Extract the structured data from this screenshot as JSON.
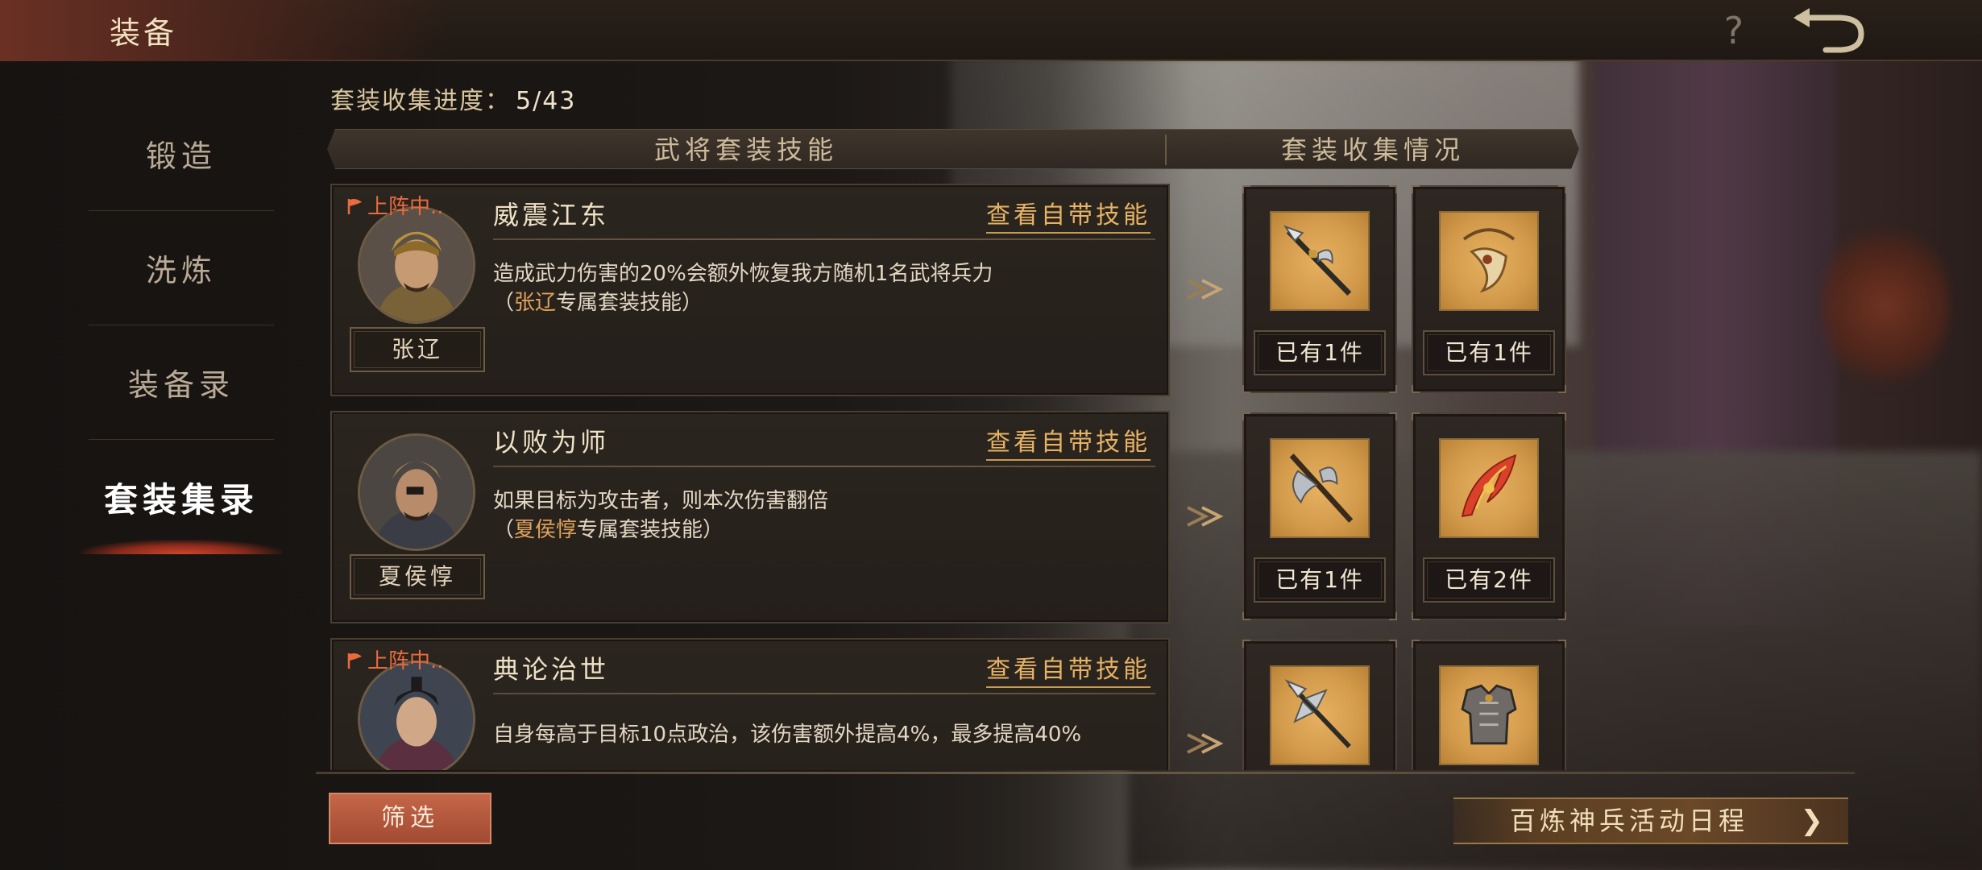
{
  "header": {
    "title": "装备",
    "help_icon": "question-mark-icon",
    "back_icon": "back-arrow-icon"
  },
  "sidebar": {
    "items": [
      {
        "label": "锻造",
        "active": false
      },
      {
        "label": "洗炼",
        "active": false
      },
      {
        "label": "装备录",
        "active": false
      },
      {
        "label": "套装集录",
        "active": true
      }
    ]
  },
  "progress": {
    "label": "套装收集进度：",
    "value": "5/43"
  },
  "columns": {
    "left": "武将套装技能",
    "right": "套装收集情况"
  },
  "sets": [
    {
      "deployed": true,
      "deployed_label": "上阵中..",
      "general": "张辽",
      "skill_name": "威震江东",
      "view_label": "查看自带技能",
      "desc": "造成武力伤害的20%会额外恢复我方随机1名武将兵力",
      "excl_open": "（",
      "excl_hero": "张辽",
      "excl_text": "专属套装技能）",
      "items": [
        {
          "icon": "halberd-icon",
          "count": "已有1件"
        },
        {
          "icon": "horn-pendant-icon",
          "count": "已有1件"
        }
      ]
    },
    {
      "deployed": false,
      "deployed_label": "",
      "general": "夏侯惇",
      "skill_name": "以败为师",
      "view_label": "查看自带技能",
      "desc": "如果目标为攻击者，则本次伤害翻倍",
      "excl_open": "（",
      "excl_hero": "夏侯惇",
      "excl_text": "专属套装技能）",
      "items": [
        {
          "icon": "battle-axe-icon",
          "count": "已有1件"
        },
        {
          "icon": "phoenix-feather-icon",
          "count": "已有2件"
        }
      ]
    },
    {
      "deployed": true,
      "deployed_label": "上阵中..",
      "general": "",
      "skill_name": "典论治世",
      "view_label": "查看自带技能",
      "desc": "自身每高于目标10点政治，该伤害额外提高4%，最多提高40%",
      "excl_open": "",
      "excl_hero": "",
      "excl_text": "",
      "items": [
        {
          "icon": "trident-spear-icon",
          "count": ""
        },
        {
          "icon": "armor-icon",
          "count": ""
        }
      ]
    }
  ],
  "footer": {
    "filter_label": "筛选",
    "event_label": "百炼神兵活动日程",
    "event_chevron": "❯"
  },
  "colors": {
    "accent": "#e6b265",
    "deploy": "#e86a3f",
    "active_glow": "#d2462b"
  }
}
